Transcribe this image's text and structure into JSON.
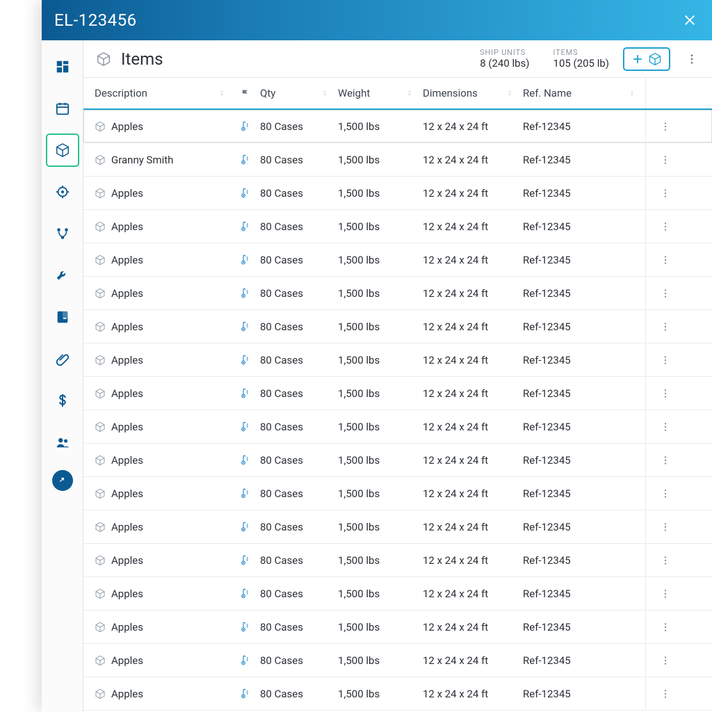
{
  "titlebar": {
    "title": "EL-123456"
  },
  "sidebar": {
    "items": [
      {
        "id": "dashboard",
        "icon": "dashboard"
      },
      {
        "id": "calendar",
        "icon": "calendar"
      },
      {
        "id": "items",
        "icon": "package",
        "active": true
      },
      {
        "id": "location",
        "icon": "target"
      },
      {
        "id": "route",
        "icon": "route"
      },
      {
        "id": "tools",
        "icon": "wrench"
      },
      {
        "id": "docs",
        "icon": "book"
      },
      {
        "id": "attach",
        "icon": "paperclip"
      },
      {
        "id": "finance",
        "icon": "dollar"
      },
      {
        "id": "users",
        "icon": "users"
      },
      {
        "id": "expand",
        "icon": "expand",
        "style": "filled"
      }
    ]
  },
  "header": {
    "title": "Items",
    "stats": [
      {
        "label": "SHIP UNITS",
        "value": "8 (240 lbs)"
      },
      {
        "label": "ITEMS",
        "value": "105 (205 lb)"
      }
    ]
  },
  "columns": {
    "description": "Description",
    "qty": "Qty",
    "weight": "Weight",
    "dimensions": "Dimensions",
    "ref": "Ref. Name"
  },
  "rows": [
    {
      "desc": "Apples",
      "qty": "80 Cases",
      "weight": "1,500 lbs",
      "dim": "12 x 24 x 24 ft",
      "ref": "Ref-12345",
      "selected": true
    },
    {
      "desc": "Granny Smith",
      "qty": "80 Cases",
      "weight": "1,500 lbs",
      "dim": "12 x 24 x 24 ft",
      "ref": "Ref-12345"
    },
    {
      "desc": "Apples",
      "qty": "80 Cases",
      "weight": "1,500 lbs",
      "dim": "12 x 24 x 24 ft",
      "ref": "Ref-12345"
    },
    {
      "desc": "Apples",
      "qty": "80 Cases",
      "weight": "1,500 lbs",
      "dim": "12 x 24 x 24 ft",
      "ref": "Ref-12345"
    },
    {
      "desc": "Apples",
      "qty": "80 Cases",
      "weight": "1,500 lbs",
      "dim": "12 x 24 x 24 ft",
      "ref": "Ref-12345"
    },
    {
      "desc": "Apples",
      "qty": "80 Cases",
      "weight": "1,500 lbs",
      "dim": "12 x 24 x 24 ft",
      "ref": "Ref-12345"
    },
    {
      "desc": "Apples",
      "qty": "80 Cases",
      "weight": "1,500 lbs",
      "dim": "12 x 24 x 24 ft",
      "ref": "Ref-12345"
    },
    {
      "desc": "Apples",
      "qty": "80 Cases",
      "weight": "1,500 lbs",
      "dim": "12 x 24 x 24 ft",
      "ref": "Ref-12345"
    },
    {
      "desc": "Apples",
      "qty": "80 Cases",
      "weight": "1,500 lbs",
      "dim": "12 x 24 x 24 ft",
      "ref": "Ref-12345"
    },
    {
      "desc": "Apples",
      "qty": "80 Cases",
      "weight": "1,500 lbs",
      "dim": "12 x 24 x 24 ft",
      "ref": "Ref-12345"
    },
    {
      "desc": "Apples",
      "qty": "80 Cases",
      "weight": "1,500 lbs",
      "dim": "12 x 24 x 24 ft",
      "ref": "Ref-12345"
    },
    {
      "desc": "Apples",
      "qty": "80 Cases",
      "weight": "1,500 lbs",
      "dim": "12 x 24 x 24 ft",
      "ref": "Ref-12345"
    },
    {
      "desc": "Apples",
      "qty": "80 Cases",
      "weight": "1,500 lbs",
      "dim": "12 x 24 x 24 ft",
      "ref": "Ref-12345"
    },
    {
      "desc": "Apples",
      "qty": "80 Cases",
      "weight": "1,500 lbs",
      "dim": "12 x 24 x 24 ft",
      "ref": "Ref-12345"
    },
    {
      "desc": "Apples",
      "qty": "80 Cases",
      "weight": "1,500 lbs",
      "dim": "12 x 24 x 24 ft",
      "ref": "Ref-12345"
    },
    {
      "desc": "Apples",
      "qty": "80 Cases",
      "weight": "1,500 lbs",
      "dim": "12 x 24 x 24 ft",
      "ref": "Ref-12345"
    },
    {
      "desc": "Apples",
      "qty": "80 Cases",
      "weight": "1,500 lbs",
      "dim": "12 x 24 x 24 ft",
      "ref": "Ref-12345"
    },
    {
      "desc": "Apples",
      "qty": "80 Cases",
      "weight": "1,500 lbs",
      "dim": "12 x 24 x 24 ft",
      "ref": "Ref-12345"
    }
  ]
}
